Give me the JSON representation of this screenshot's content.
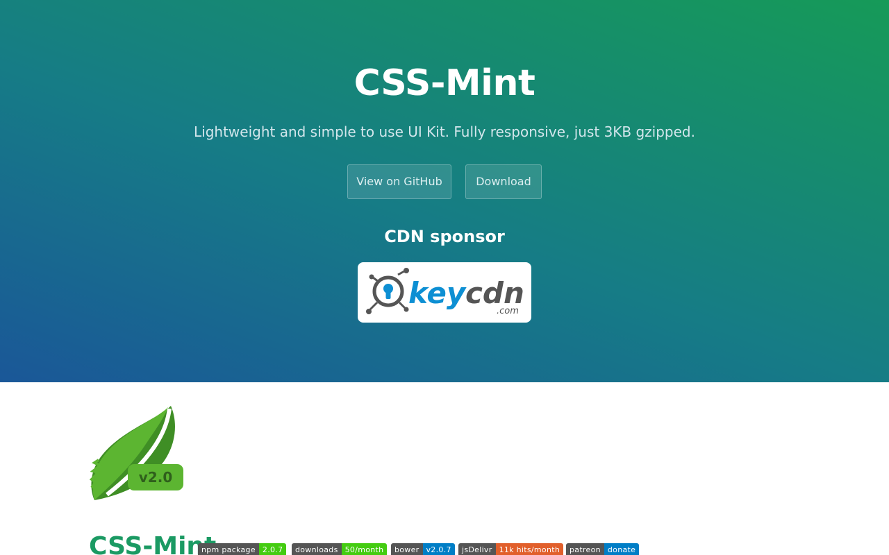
{
  "hero": {
    "title": "CSS-Mint",
    "subtitle": "Lightweight and simple to use UI Kit. Fully responsive, just 3KB gzipped.",
    "buttons": {
      "github": "View on GitHub",
      "download": "Download"
    },
    "sponsor_heading": "CDN sponsor",
    "sponsor_logo": {
      "name": "keycdn-logo",
      "text_main": "keycdn",
      "text_sub": ".com"
    }
  },
  "logo": {
    "icon": "mint-leaf-icon",
    "version": "v2.0"
  },
  "content": {
    "title": "CSS-Mint",
    "badges": [
      {
        "label": "npm package",
        "value": "2.0.7",
        "color": "#4c1"
      },
      {
        "label": "downloads",
        "value": "50/month",
        "color": "#4c1"
      },
      {
        "label": "bower",
        "value": "v2.0.7",
        "color": "#007ec6"
      },
      {
        "label": "jsDelivr",
        "value": "11k hits/month",
        "color": "#e15f2b"
      },
      {
        "label": "patreon",
        "value": "donate",
        "color": "#007ec6"
      }
    ]
  },
  "colors": {
    "gradient_start": "#1a5798",
    "gradient_end": "#169a58",
    "accent_green": "#1b9a63"
  }
}
